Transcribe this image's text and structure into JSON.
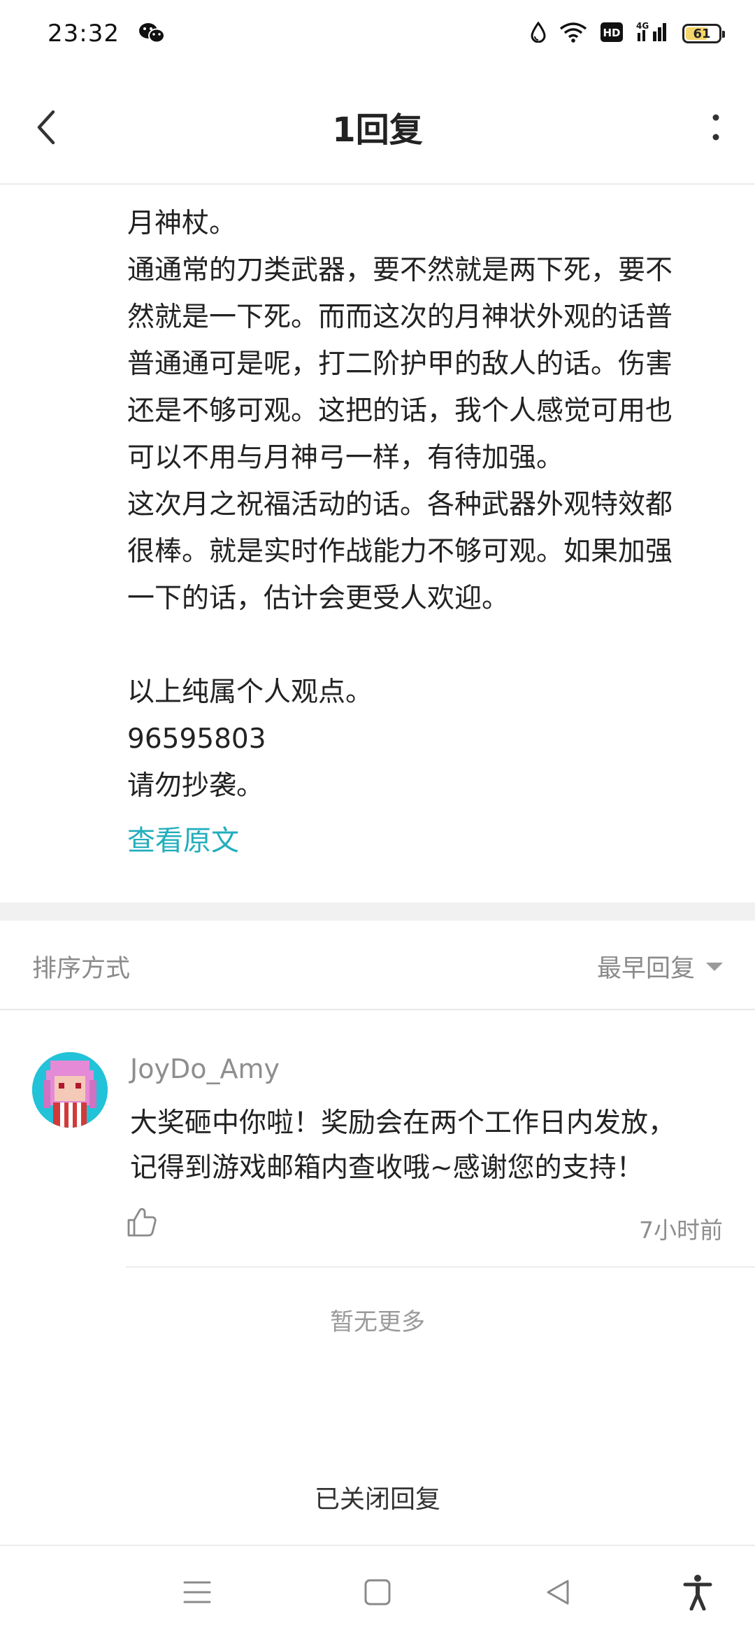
{
  "status_bar": {
    "time": "23:32",
    "battery_level": "61",
    "network_label": "4G",
    "hd_label": "HD",
    "icons": [
      "wechat-icon",
      "drop-icon",
      "wifi-icon",
      "hd-icon",
      "signal-icon",
      "battery-icon"
    ]
  },
  "header": {
    "title": "1回复"
  },
  "post": {
    "lines": [
      "月神杖。",
      "通通常的刀类武器，要不然就是两下死，要不",
      "然就是一下死。而而这次的月神状外观的话普",
      "普通通可是呢，打二阶护甲的敌人的话。伤害",
      "还是不够可观。这把的话，我个人感觉可用也",
      "可以不用与月神弓一样，有待加强。",
      "这次月之祝福活动的话。各种武器外观特效都",
      "很棒。就是实时作战能力不够可观。如果加强",
      "一下的话，估计会更受人欢迎。",
      "",
      "以上纯属个人观点。",
      "96595803",
      "请勿抄袭。"
    ],
    "view_original": "查看原文"
  },
  "sort": {
    "label": "排序方式",
    "selected": "最早回复"
  },
  "reply": {
    "username": "JoyDo_Amy",
    "lines": [
      "大奖砸中你啦！奖励会在两个工作日内发放，",
      "记得到游戏邮箱内查收哦~感谢您的支持！"
    ],
    "time": "7小时前"
  },
  "no_more": "暂无更多",
  "closed": "已关闭回复",
  "colors": {
    "accent": "#22aebc",
    "battery": "#f3d56b",
    "avatar_bg": "#22c2d8",
    "muted_text": "#8e8e8e"
  }
}
